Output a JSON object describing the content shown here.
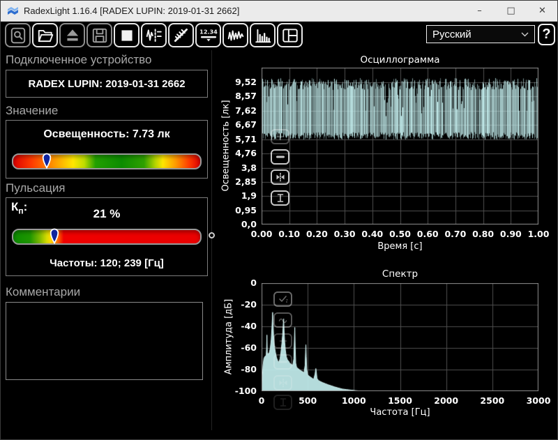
{
  "window": {
    "title": "RadexLight 1.16.4 [RADEX LUPIN: 2019-01-31 2662]",
    "controls": {
      "minimize": "–",
      "maximize": "□",
      "close": "✕"
    }
  },
  "toolbar": {
    "buttons": [
      {
        "name": "preview",
        "enabled": false
      },
      {
        "name": "open",
        "enabled": true
      },
      {
        "name": "eject",
        "enabled": false
      },
      {
        "name": "save",
        "enabled": false
      },
      {
        "name": "stop",
        "enabled": true
      },
      {
        "name": "record-marks",
        "enabled": true
      },
      {
        "name": "rays",
        "enabled": true
      },
      {
        "name": "numeric-display",
        "enabled": true
      },
      {
        "name": "oscillogram-view",
        "enabled": true
      },
      {
        "name": "spectrum-view",
        "enabled": true
      },
      {
        "name": "layout",
        "enabled": true
      }
    ],
    "language": {
      "value": "Русский"
    },
    "help_label": "?"
  },
  "left_panel": {
    "device": {
      "header": "Подключенное устройство",
      "name": "RADEX LUPIN: 2019-01-31 2662"
    },
    "value": {
      "header": "Значение",
      "reading": "Освещенность: 7.73 лк",
      "marker_pct": 18,
      "gradient": [
        "#dd0000 0%",
        "#ff3c00 10%",
        "#ff9900 22%",
        "#ffe600 32%",
        "#bfdc00 38%",
        "#22a000 44%",
        "#0c8c00 58%",
        "#2fa000 70%",
        "#b4d400 76%",
        "#ffe600 80%",
        "#ff9900 87%",
        "#ff3c00 94%",
        "#dd0000 100%"
      ]
    },
    "pulsation": {
      "header": "Пульсация",
      "kp_letter": "К",
      "kp_sub": "п",
      "kp_colon": ":",
      "value": "21 %",
      "marker_pct": 22,
      "frequencies": "Частоты: 120; 239 [Гц]",
      "gradient": [
        "#0c8c00 0%",
        "#1e9600 9%",
        "#7ab800 14%",
        "#d8dc00 18%",
        "#ffd800 20%",
        "#ff8400 23%",
        "#f00000 27%",
        "#ea0000 100%"
      ]
    },
    "comments": {
      "header": "Комментарии",
      "text": ""
    }
  },
  "chart_data": [
    {
      "type": "line",
      "title": "Осциллограмма",
      "xlabel": "Время [с]",
      "ylabel": "Освещенность [лк]",
      "xlim": [
        0,
        1
      ],
      "ylim": [
        0,
        10.5
      ],
      "x_tick_values": [
        0,
        0.1,
        0.2,
        0.3,
        0.4,
        0.5,
        0.6,
        0.7,
        0.8,
        0.9,
        1.0
      ],
      "x_tick_labels": [
        "0.00",
        "0.10",
        "0.20",
        "0.30",
        "0.40",
        "0.50",
        "0.60",
        "0.70",
        "0.80",
        "0.90",
        "1.00"
      ],
      "y_tick_values": [
        0,
        0.95,
        1.9,
        2.85,
        3.8,
        4.76,
        5.71,
        6.67,
        7.62,
        8.57,
        9.52
      ],
      "y_tick_labels": [
        "0,0",
        "0,95",
        "1,9",
        "2,85",
        "3,8",
        "4,76",
        "5,71",
        "6,67",
        "7,62",
        "8,57",
        "9,52"
      ],
      "grid": true,
      "color": "#c2ecec",
      "signal": {
        "description": "dense 120 Hz flicker waveform",
        "min": 5.71,
        "max": 9.52,
        "mean": 7.73,
        "top_min": 9.0,
        "top_max": 9.8,
        "base_min": 5.68,
        "base_max": 6.18,
        "dip_probability": 0.07,
        "dip_min": 7.2,
        "dip_max": 8.8,
        "seed": 20190131
      },
      "controls": [
        "zoom-in",
        "zoom-out",
        "fit-horizontal",
        "fit-vertical"
      ]
    },
    {
      "type": "area",
      "title": "Спектр",
      "xlabel": "Частота [Гц]",
      "ylabel": "Амплитуда [дБ]",
      "xlim": [
        0,
        3000
      ],
      "ylim": [
        -100,
        0
      ],
      "x_tick_values": [
        0,
        500,
        1000,
        1500,
        2000,
        2500,
        3000
      ],
      "x_tick_labels": [
        "0",
        "500",
        "1000",
        "1500",
        "2000",
        "2500",
        "3000"
      ],
      "y_tick_values": [
        0,
        -20,
        -40,
        -60,
        -80,
        -100
      ],
      "y_tick_labels": [
        "0",
        "-20",
        "-40",
        "-60",
        "-80",
        "-100"
      ],
      "grid": true,
      "color": "#c2ecec",
      "peaks": [
        [
          58,
          -48
        ],
        [
          120,
          -27
        ],
        [
          239,
          -33
        ],
        [
          360,
          -41
        ],
        [
          480,
          -57
        ],
        [
          590,
          -78
        ]
      ],
      "envelope": [
        [
          0,
          -100
        ],
        [
          8,
          -88
        ],
        [
          16,
          -76
        ],
        [
          25,
          -70
        ],
        [
          35,
          -68
        ],
        [
          50,
          -67
        ],
        [
          55,
          -60
        ],
        [
          58,
          -48
        ],
        [
          62,
          -64
        ],
        [
          72,
          -66
        ],
        [
          85,
          -64
        ],
        [
          95,
          -60
        ],
        [
          105,
          -52
        ],
        [
          112,
          -42
        ],
        [
          117,
          -33
        ],
        [
          120,
          -27
        ],
        [
          124,
          -36
        ],
        [
          130,
          -48
        ],
        [
          138,
          -58
        ],
        [
          150,
          -64
        ],
        [
          162,
          -69
        ],
        [
          175,
          -72
        ],
        [
          188,
          -73
        ],
        [
          200,
          -70
        ],
        [
          210,
          -64
        ],
        [
          220,
          -56
        ],
        [
          228,
          -48
        ],
        [
          234,
          -40
        ],
        [
          239,
          -33
        ],
        [
          244,
          -44
        ],
        [
          250,
          -54
        ],
        [
          258,
          -62
        ],
        [
          268,
          -68
        ],
        [
          280,
          -71
        ],
        [
          292,
          -72
        ],
        [
          305,
          -74
        ],
        [
          320,
          -75
        ],
        [
          338,
          -76
        ],
        [
          350,
          -70
        ],
        [
          356,
          -52
        ],
        [
          360,
          -41
        ],
        [
          364,
          -58
        ],
        [
          370,
          -74
        ],
        [
          380,
          -78
        ],
        [
          395,
          -79
        ],
        [
          410,
          -80
        ],
        [
          425,
          -81
        ],
        [
          445,
          -82
        ],
        [
          460,
          -83
        ],
        [
          472,
          -76
        ],
        [
          477,
          -64
        ],
        [
          480,
          -57
        ],
        [
          484,
          -68
        ],
        [
          490,
          -80
        ],
        [
          500,
          -85
        ],
        [
          515,
          -86
        ],
        [
          530,
          -87
        ],
        [
          548,
          -88
        ],
        [
          565,
          -89
        ],
        [
          580,
          -84
        ],
        [
          588,
          -79
        ],
        [
          593,
          -82
        ],
        [
          600,
          -88
        ],
        [
          615,
          -90
        ],
        [
          635,
          -91
        ],
        [
          660,
          -92
        ],
        [
          690,
          -93
        ],
        [
          720,
          -94
        ],
        [
          755,
          -95
        ],
        [
          790,
          -96
        ],
        [
          830,
          -97
        ],
        [
          875,
          -98
        ],
        [
          920,
          -98.5
        ],
        [
          970,
          -99
        ],
        [
          1020,
          -99.5
        ],
        [
          1100,
          -100
        ],
        [
          1500,
          -100
        ],
        [
          2000,
          -100
        ],
        [
          2500,
          -100
        ],
        [
          3000,
          -100
        ]
      ],
      "controls": [
        "select",
        "smooth",
        "zoom-in",
        "zoom-out",
        "fit-horizontal",
        "fit-vertical"
      ]
    }
  ],
  "colors": {
    "waveform": "#c2ecec",
    "grid": "#4f4f4f",
    "frame": "#8f8f8f",
    "logo_blue": "#2f6fd0"
  }
}
